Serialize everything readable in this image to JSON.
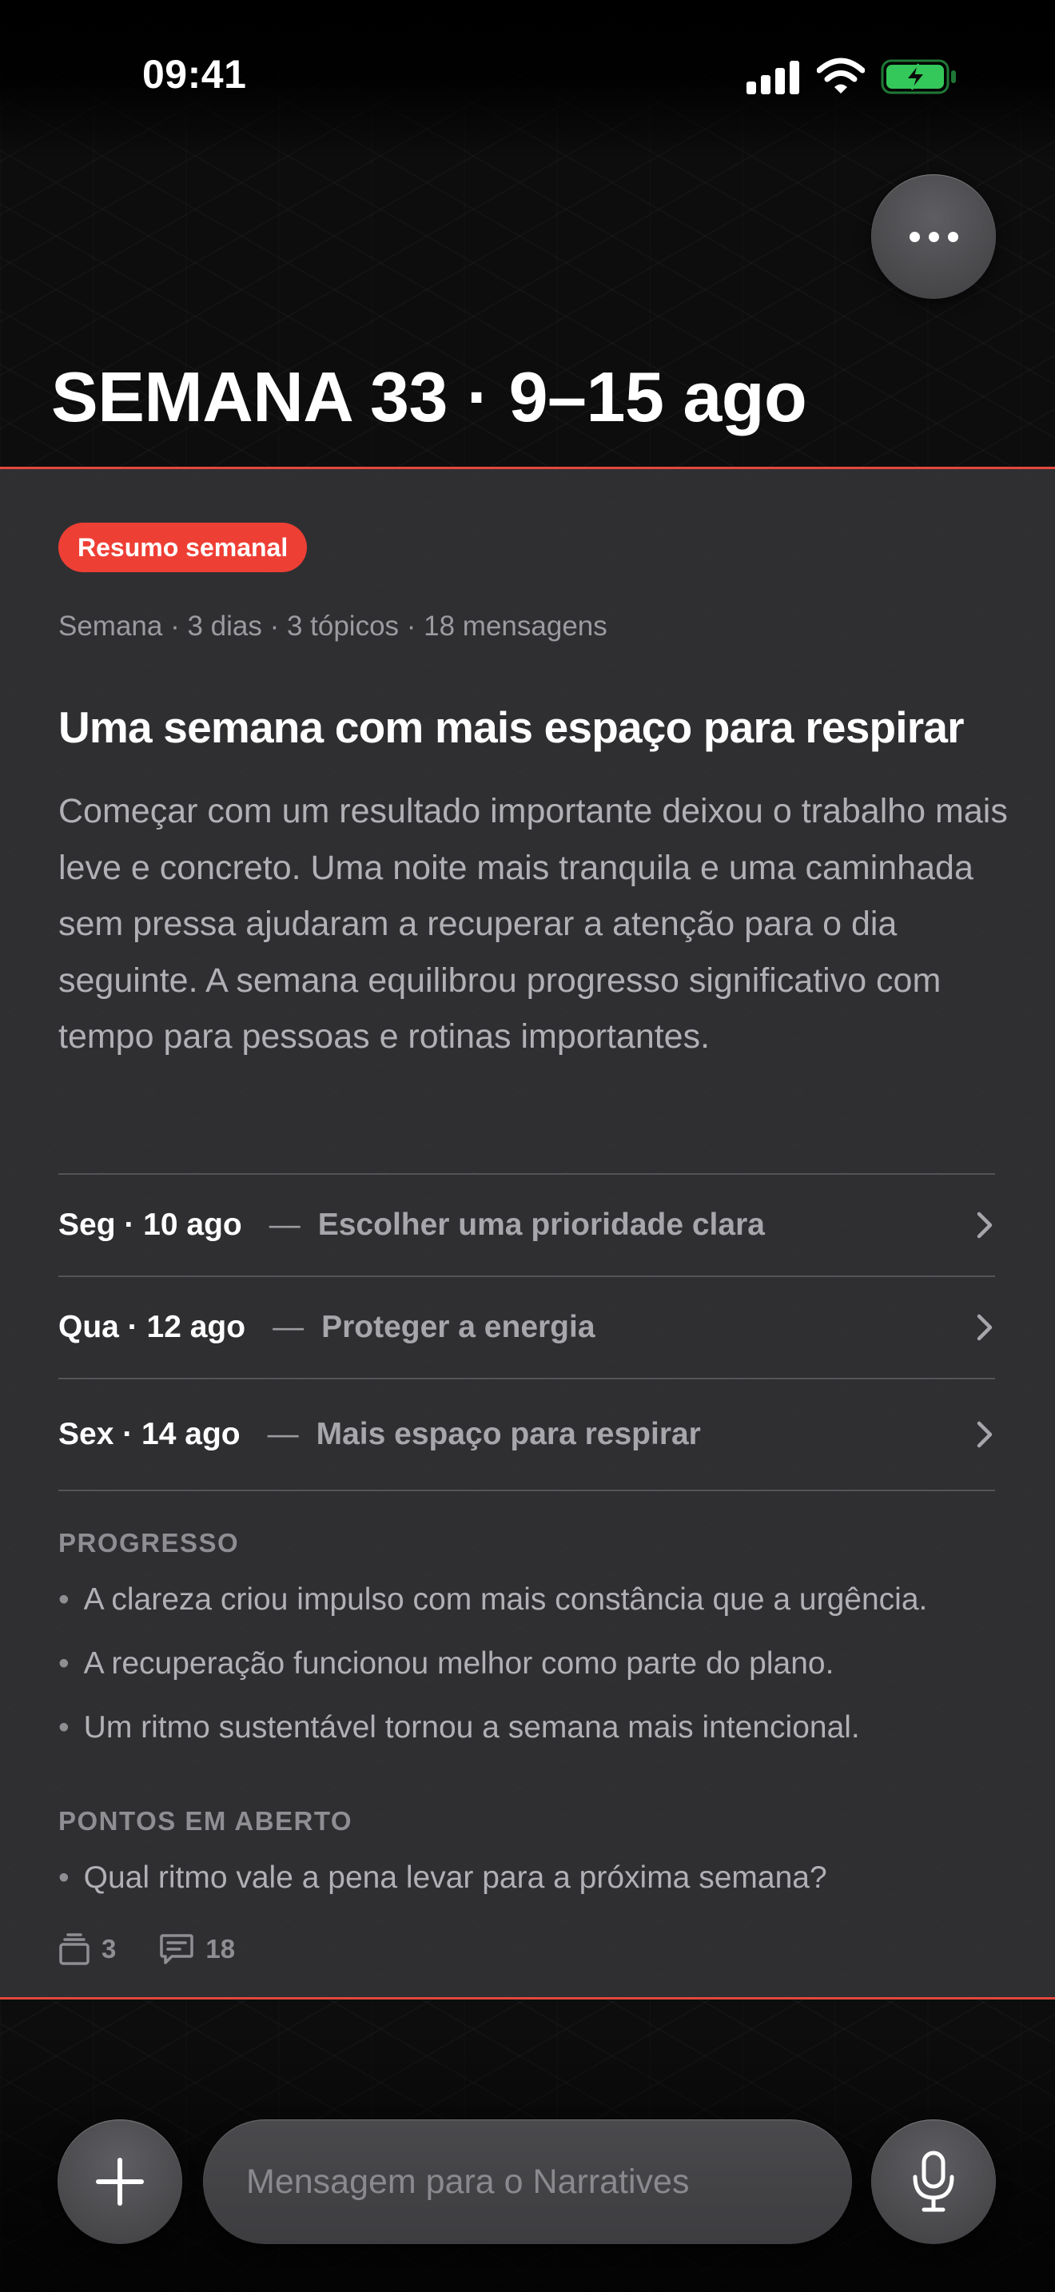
{
  "status_bar": {
    "time": "09:41",
    "icons": [
      "cellular-signal-icon",
      "wifi-icon",
      "battery-charging-icon"
    ],
    "battery_color": "#34c759"
  },
  "header": {
    "more_icon": "ellipsis-icon",
    "title": "SEMANA 33 · 9–15 ago"
  },
  "card": {
    "accent_color": "#e2483c",
    "badge": "Resumo semanal",
    "badge_color": "#ee3f35",
    "meta": "Semana · 3 dias · 3 tópicos · 18 mensagens",
    "headline": "Uma semana com mais espaço para respirar",
    "summary": "Começar com um resultado importante deixou o trabalho mais leve e concreto. Uma noite mais tranquila e uma caminhada sem pressa ajudaram a recuperar a atenção para o dia seguinte. A semana equilibrou progresso significativo com tempo para pessoas e rotinas importantes.",
    "days": [
      {
        "date": "Seg · 10 ago",
        "separator": "—",
        "topic": "Escolher uma prioridade clara"
      },
      {
        "date": "Qua · 12 ago",
        "separator": "—",
        "topic": "Proteger a energia"
      },
      {
        "date": "Sex · 14 ago",
        "separator": "—",
        "topic": "Mais espaço para respirar"
      }
    ],
    "progress": {
      "label": "PROGRESSO",
      "items": [
        "A clareza criou impulso com mais constância que a urgência.",
        "A recuperação funcionou melhor como parte do plano.",
        "Um ritmo sustentável tornou a semana mais intencional."
      ]
    },
    "open_points": {
      "label": "PONTOS EM ABERTO",
      "items": [
        "Qual ritmo vale a pena levar para a próxima semana?"
      ]
    },
    "counts": {
      "topics": "3",
      "topics_icon": "stack-icon",
      "messages": "18",
      "messages_icon": "message-icon"
    }
  },
  "composer": {
    "add_icon": "plus-icon",
    "placeholder": "Mensagem para o Narratives",
    "value": "",
    "mic_icon": "microphone-icon"
  }
}
